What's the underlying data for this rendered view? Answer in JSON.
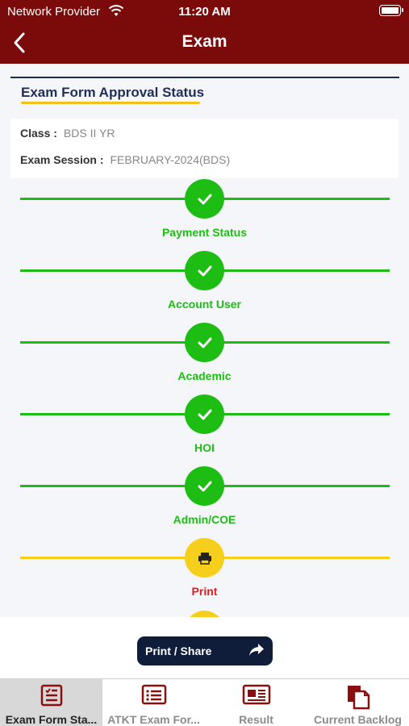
{
  "status_bar": {
    "carrier": "Network Provider",
    "time": "11:20 AM"
  },
  "nav": {
    "title": "Exam",
    "back_icon": "chevron-left-icon"
  },
  "section": {
    "title": "Exam Form Approval Status"
  },
  "info": {
    "class_label": "Class :",
    "class_value": "BDS II YR",
    "session_label": "Exam Session :",
    "session_value": "FEBRUARY-2024(BDS)"
  },
  "steps": [
    {
      "label": "Payment Status",
      "state": "done",
      "icon": "check-icon"
    },
    {
      "label": "Account User",
      "state": "done",
      "icon": "check-icon"
    },
    {
      "label": "Academic",
      "state": "done",
      "icon": "check-icon"
    },
    {
      "label": "HOI",
      "state": "done",
      "icon": "check-icon"
    },
    {
      "label": "Admin/COE",
      "state": "done",
      "icon": "check-icon"
    },
    {
      "label": "Print",
      "state": "pending",
      "icon": "printer-icon"
    }
  ],
  "print_share": {
    "label": "Print / Share",
    "icon": "share-arrow-icon"
  },
  "tabs": [
    {
      "label": "Exam Form Sta...",
      "icon": "form-list-icon",
      "active": true
    },
    {
      "label": "ATKT Exam For...",
      "icon": "list-icon",
      "active": false
    },
    {
      "label": "Result",
      "icon": "newspaper-icon",
      "active": false
    },
    {
      "label": "Current Backlog",
      "icon": "document-copy-icon",
      "active": false
    }
  ],
  "colors": {
    "header": "#7b0a0a",
    "success": "#1ebd14",
    "pending": "#f6cf1c",
    "pending_text": "#e41b1b",
    "navy": "#1f2f57",
    "accent_tab_icon": "#8a1010"
  }
}
